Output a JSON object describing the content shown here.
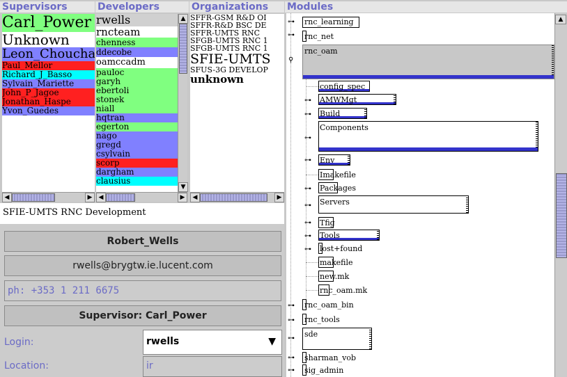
{
  "headers": {
    "supervisors": "Supervisors",
    "developers": "Developers",
    "organizations": "Organizations",
    "modules": "Modules"
  },
  "supervisors": [
    {
      "name": "Carl_Power",
      "color": "#80ff80"
    },
    {
      "name": "Unknown",
      "color": "#ffffff"
    },
    {
      "name": "Leon_Choucha",
      "color": "#8080ff"
    },
    {
      "name": "Paul_Mellor",
      "color": "#ff2020"
    },
    {
      "name": "Richard_J_Basso",
      "color": "#00ffff"
    },
    {
      "name": "Sylvain_Mariette",
      "color": "#8080ff"
    },
    {
      "name": "John_P_Jagoe",
      "color": "#ff2020"
    },
    {
      "name": "Jonathan_Haspe",
      "color": "#ff2020"
    },
    {
      "name": "Yvon_Guedes",
      "color": "#8080ff"
    }
  ],
  "developers": [
    {
      "name": "rwells",
      "color": "#d0d0d0"
    },
    {
      "name": "rncteam",
      "color": "#ffffff"
    },
    {
      "name": "chenness",
      "color": "#80ff80"
    },
    {
      "name": "ddecobe",
      "color": "#8080ff"
    },
    {
      "name": "oamccadm",
      "color": "#ffffff"
    },
    {
      "name": "pauloc",
      "color": "#80ff80"
    },
    {
      "name": "garyh",
      "color": "#80ff80"
    },
    {
      "name": "ebertoli",
      "color": "#80ff80"
    },
    {
      "name": "stonek",
      "color": "#80ff80"
    },
    {
      "name": "niall",
      "color": "#80ff80"
    },
    {
      "name": "hqtran",
      "color": "#8080ff"
    },
    {
      "name": "egerton",
      "color": "#80ff80"
    },
    {
      "name": "nago",
      "color": "#8080ff"
    },
    {
      "name": "gregd",
      "color": "#8080ff"
    },
    {
      "name": "csylvain",
      "color": "#8080ff"
    },
    {
      "name": "scorp",
      "color": "#ff2020"
    },
    {
      "name": "dargham",
      "color": "#8080ff"
    },
    {
      "name": "clausius",
      "color": "#00ffff"
    }
  ],
  "organizations": [
    {
      "name": "SFFR-GSM R&D OI",
      "size": "s"
    },
    {
      "name": "SFFR-R&D BSC DE",
      "size": "s"
    },
    {
      "name": "SFFR-UMTS RNC",
      "size": "s"
    },
    {
      "name": "SFGB-UMTS RNC 1",
      "size": "s"
    },
    {
      "name": "SFGB-UMTS RNC 1",
      "size": "s"
    },
    {
      "name": "SFIE-UMTS",
      "size": "l"
    },
    {
      "name": "SFUS-3G DEVELOP",
      "size": "s"
    },
    {
      "name": "unknown",
      "size": "m"
    }
  ],
  "detail": {
    "org_label": "SFIE-UMTS RNC Development",
    "full_name": "Robert_Wells",
    "email": "rwells@brygtw.ie.lucent.com",
    "phone": "ph: +353 1 211 6675",
    "supervisor": "Supervisor: Carl_Power",
    "login_label": "Login:",
    "login_value": "rwells",
    "location_label": "Location:",
    "location_value": "ir"
  },
  "modules": {
    "top": [
      "rnc_learning",
      "rnc_net",
      "rnc_oam"
    ],
    "children": [
      "config_spec",
      "AMWMgt",
      "Build",
      "Components",
      "Env",
      "Imakefile",
      "Packages",
      "Servers",
      "Tfig",
      "Tools",
      "lost+found",
      "makefile",
      "new.mk",
      "rnc_oam.mk"
    ],
    "bottom": [
      "rnc_oam_bin",
      "rnc_tools",
      "sde",
      "sharman_vob",
      "sig_admin"
    ]
  },
  "colors": {
    "header_text": "#6b6bc6",
    "selection_blue": "#3333cc"
  }
}
